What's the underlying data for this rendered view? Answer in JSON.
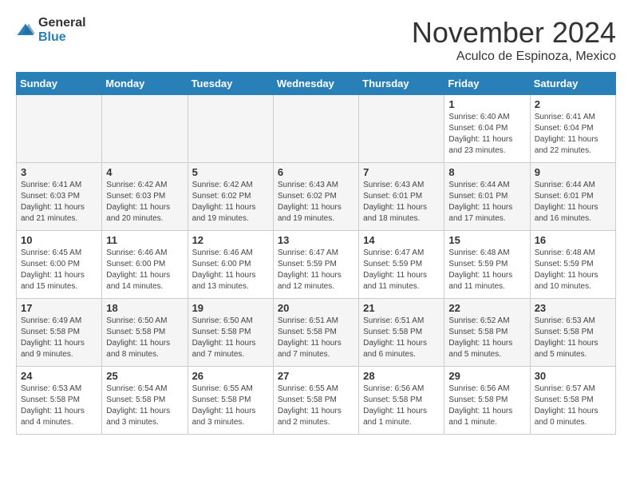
{
  "header": {
    "logo_general": "General",
    "logo_blue": "Blue",
    "month": "November 2024",
    "location": "Aculco de Espinoza, Mexico"
  },
  "weekdays": [
    "Sunday",
    "Monday",
    "Tuesday",
    "Wednesday",
    "Thursday",
    "Friday",
    "Saturday"
  ],
  "weeks": [
    [
      {
        "day": "",
        "info": ""
      },
      {
        "day": "",
        "info": ""
      },
      {
        "day": "",
        "info": ""
      },
      {
        "day": "",
        "info": ""
      },
      {
        "day": "",
        "info": ""
      },
      {
        "day": "1",
        "info": "Sunrise: 6:40 AM\nSunset: 6:04 PM\nDaylight: 11 hours\nand 23 minutes."
      },
      {
        "day": "2",
        "info": "Sunrise: 6:41 AM\nSunset: 6:04 PM\nDaylight: 11 hours\nand 22 minutes."
      }
    ],
    [
      {
        "day": "3",
        "info": "Sunrise: 6:41 AM\nSunset: 6:03 PM\nDaylight: 11 hours\nand 21 minutes."
      },
      {
        "day": "4",
        "info": "Sunrise: 6:42 AM\nSunset: 6:03 PM\nDaylight: 11 hours\nand 20 minutes."
      },
      {
        "day": "5",
        "info": "Sunrise: 6:42 AM\nSunset: 6:02 PM\nDaylight: 11 hours\nand 19 minutes."
      },
      {
        "day": "6",
        "info": "Sunrise: 6:43 AM\nSunset: 6:02 PM\nDaylight: 11 hours\nand 19 minutes."
      },
      {
        "day": "7",
        "info": "Sunrise: 6:43 AM\nSunset: 6:01 PM\nDaylight: 11 hours\nand 18 minutes."
      },
      {
        "day": "8",
        "info": "Sunrise: 6:44 AM\nSunset: 6:01 PM\nDaylight: 11 hours\nand 17 minutes."
      },
      {
        "day": "9",
        "info": "Sunrise: 6:44 AM\nSunset: 6:01 PM\nDaylight: 11 hours\nand 16 minutes."
      }
    ],
    [
      {
        "day": "10",
        "info": "Sunrise: 6:45 AM\nSunset: 6:00 PM\nDaylight: 11 hours\nand 15 minutes."
      },
      {
        "day": "11",
        "info": "Sunrise: 6:46 AM\nSunset: 6:00 PM\nDaylight: 11 hours\nand 14 minutes."
      },
      {
        "day": "12",
        "info": "Sunrise: 6:46 AM\nSunset: 6:00 PM\nDaylight: 11 hours\nand 13 minutes."
      },
      {
        "day": "13",
        "info": "Sunrise: 6:47 AM\nSunset: 5:59 PM\nDaylight: 11 hours\nand 12 minutes."
      },
      {
        "day": "14",
        "info": "Sunrise: 6:47 AM\nSunset: 5:59 PM\nDaylight: 11 hours\nand 11 minutes."
      },
      {
        "day": "15",
        "info": "Sunrise: 6:48 AM\nSunset: 5:59 PM\nDaylight: 11 hours\nand 11 minutes."
      },
      {
        "day": "16",
        "info": "Sunrise: 6:48 AM\nSunset: 5:59 PM\nDaylight: 11 hours\nand 10 minutes."
      }
    ],
    [
      {
        "day": "17",
        "info": "Sunrise: 6:49 AM\nSunset: 5:58 PM\nDaylight: 11 hours\nand 9 minutes."
      },
      {
        "day": "18",
        "info": "Sunrise: 6:50 AM\nSunset: 5:58 PM\nDaylight: 11 hours\nand 8 minutes."
      },
      {
        "day": "19",
        "info": "Sunrise: 6:50 AM\nSunset: 5:58 PM\nDaylight: 11 hours\nand 7 minutes."
      },
      {
        "day": "20",
        "info": "Sunrise: 6:51 AM\nSunset: 5:58 PM\nDaylight: 11 hours\nand 7 minutes."
      },
      {
        "day": "21",
        "info": "Sunrise: 6:51 AM\nSunset: 5:58 PM\nDaylight: 11 hours\nand 6 minutes."
      },
      {
        "day": "22",
        "info": "Sunrise: 6:52 AM\nSunset: 5:58 PM\nDaylight: 11 hours\nand 5 minutes."
      },
      {
        "day": "23",
        "info": "Sunrise: 6:53 AM\nSunset: 5:58 PM\nDaylight: 11 hours\nand 5 minutes."
      }
    ],
    [
      {
        "day": "24",
        "info": "Sunrise: 6:53 AM\nSunset: 5:58 PM\nDaylight: 11 hours\nand 4 minutes."
      },
      {
        "day": "25",
        "info": "Sunrise: 6:54 AM\nSunset: 5:58 PM\nDaylight: 11 hours\nand 3 minutes."
      },
      {
        "day": "26",
        "info": "Sunrise: 6:55 AM\nSunset: 5:58 PM\nDaylight: 11 hours\nand 3 minutes."
      },
      {
        "day": "27",
        "info": "Sunrise: 6:55 AM\nSunset: 5:58 PM\nDaylight: 11 hours\nand 2 minutes."
      },
      {
        "day": "28",
        "info": "Sunrise: 6:56 AM\nSunset: 5:58 PM\nDaylight: 11 hours\nand 1 minute."
      },
      {
        "day": "29",
        "info": "Sunrise: 6:56 AM\nSunset: 5:58 PM\nDaylight: 11 hours\nand 1 minute."
      },
      {
        "day": "30",
        "info": "Sunrise: 6:57 AM\nSunset: 5:58 PM\nDaylight: 11 hours\nand 0 minutes."
      }
    ]
  ]
}
